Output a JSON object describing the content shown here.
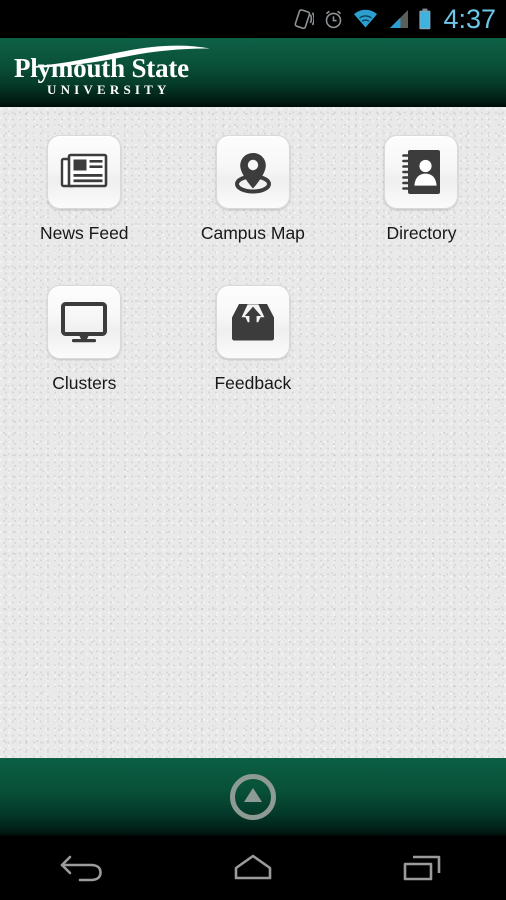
{
  "status_bar": {
    "time": "4:37",
    "icons": [
      {
        "name": "vibrate-icon",
        "label": "vibrate"
      },
      {
        "name": "alarm-clock-icon",
        "label": "alarm"
      },
      {
        "name": "wifi-icon",
        "label": "wifi"
      },
      {
        "name": "cellular-signal-icon",
        "label": "signal"
      },
      {
        "name": "battery-icon",
        "label": "battery"
      }
    ],
    "accent_color": "#6ec6e8",
    "background_color": "#000000"
  },
  "header": {
    "logo_main": "Plymouth State",
    "logo_sub": "UNIVERSITY",
    "brand_green": "#0a5139",
    "logo_color": "#ffffff"
  },
  "content": {
    "background_color": "#e9e9e9",
    "label_color": "#181818",
    "tiles": [
      {
        "label": "News Feed",
        "icon": "newspaper-icon"
      },
      {
        "label": "Campus Map",
        "icon": "map-pin-icon"
      },
      {
        "label": "Directory",
        "icon": "address-book-icon"
      },
      {
        "label": "Clusters",
        "icon": "monitor-icon"
      },
      {
        "label": "Feedback",
        "icon": "outbox-upload-icon"
      }
    ]
  },
  "footer": {
    "home_button": "home-triangle-icon",
    "brand_green": "#085138",
    "icon_color": "#9aa6a0"
  },
  "navbar": {
    "background_color": "#000000",
    "icon_color": "#9b9b9b",
    "buttons": [
      {
        "name": "nav-back-button",
        "label": "Back"
      },
      {
        "name": "nav-home-button",
        "label": "Home"
      },
      {
        "name": "nav-recents-button",
        "label": "Recents"
      }
    ]
  }
}
